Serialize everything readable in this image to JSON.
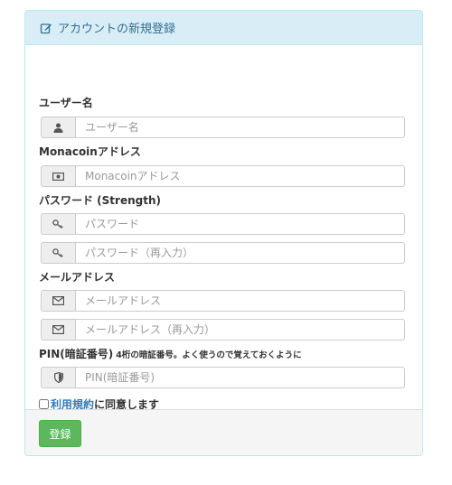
{
  "panel": {
    "title": "アカウントの新規登録",
    "title_icon": "edit-icon"
  },
  "form": {
    "username": {
      "label": "ユーザー名",
      "icon": "user-icon",
      "placeholder": "ユーザー名"
    },
    "monacoin": {
      "label": "Monacoinアドレス",
      "icon": "money-icon",
      "placeholder": "Monacoinアドレス"
    },
    "password": {
      "label": "パスワード (Strength)",
      "icon": "key-icon",
      "placeholder": "パスワード",
      "confirm_placeholder": "パスワード（再入力）"
    },
    "email": {
      "label": "メールアドレス",
      "icon": "envelope-icon",
      "placeholder": "メールアドレス",
      "confirm_placeholder": "メールアドレス（再入力）"
    },
    "pin": {
      "label": "PIN(暗証番号)",
      "hint": "4桁の暗証番号。よく使うので覚えておくように",
      "icon": "shield-icon",
      "placeholder": "PIN(暗証番号)"
    },
    "terms": {
      "link_text": "利用規約",
      "suffix": "に同意します"
    }
  },
  "footer": {
    "submit_label": "登録"
  },
  "colors": {
    "heading_bg": "#d9edf7",
    "heading_text": "#31708f",
    "link": "#337ab7",
    "submit_bg": "#5cb85c"
  }
}
